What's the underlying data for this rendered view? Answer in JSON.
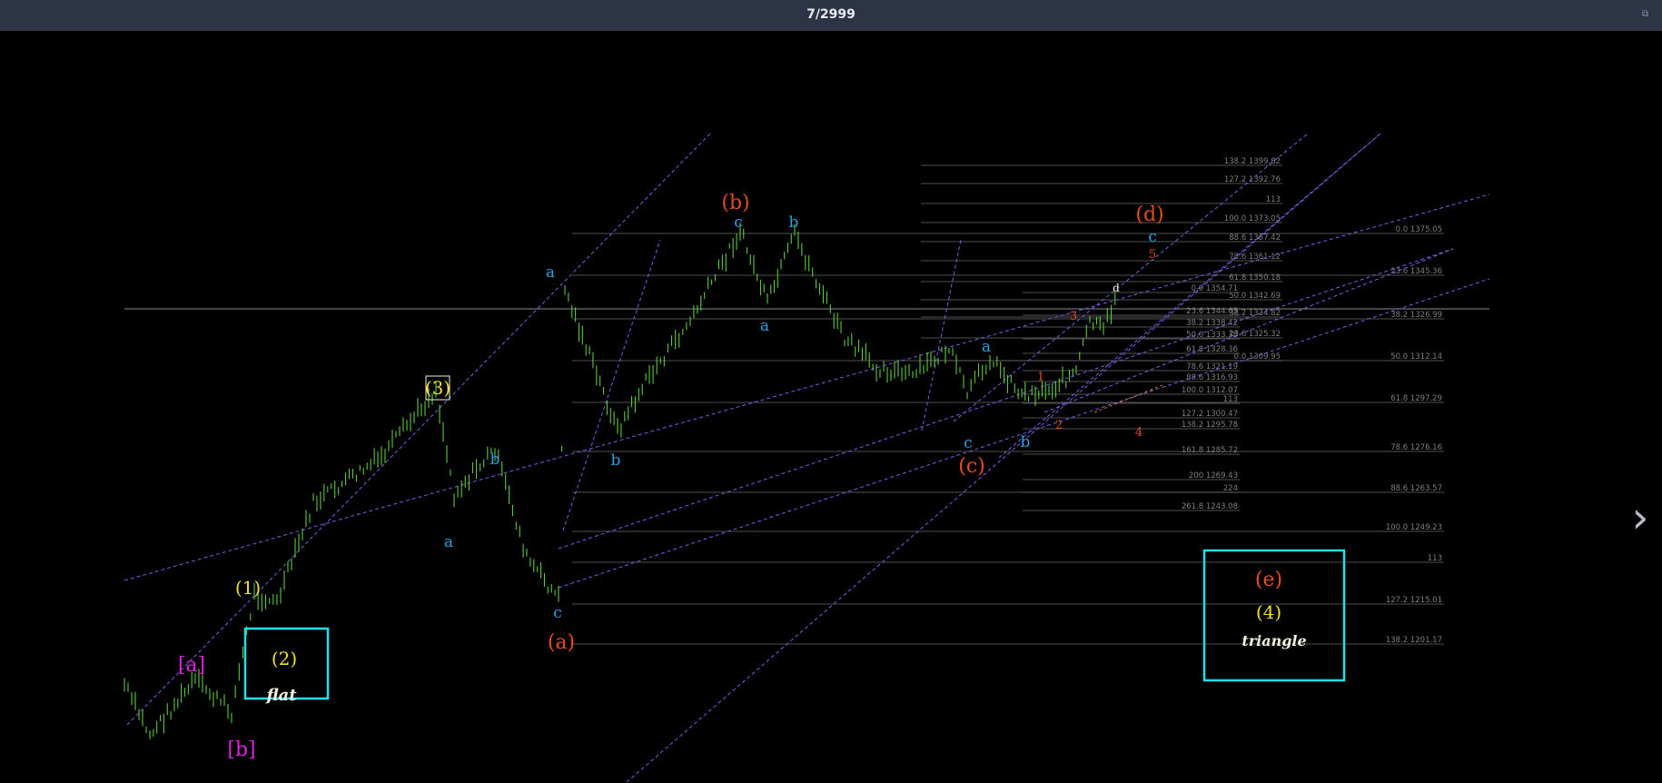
{
  "viewer": {
    "counter": "7/2999",
    "next_icon": "chevron-right-icon",
    "window_icon": "restore-icon"
  },
  "colors": {
    "candles": "#5ec83a",
    "trendline": "#6f62e0",
    "fib": "#6a6a6a",
    "fib_text": "#7e7e7e",
    "label_blue": "#2aa0e0",
    "label_red": "#e84a1e",
    "label_yellow": "#f0e020",
    "label_magenta": "#e020e0",
    "label_white": "#f4f0e0",
    "box": "#20e0e8"
  },
  "wave_labels": [
    {
      "text": "[a]",
      "color": "magenta"
    },
    {
      "text": "[b]",
      "color": "magenta"
    },
    {
      "text": "(1)",
      "color": "yellow"
    },
    {
      "text": "(2)",
      "color": "yellow"
    },
    {
      "text": "(3)",
      "color": "yellow"
    },
    {
      "text": "(4)",
      "color": "yellow"
    },
    {
      "text": "(a)",
      "color": "red"
    },
    {
      "text": "(b)",
      "color": "red"
    },
    {
      "text": "(c)",
      "color": "red"
    },
    {
      "text": "(d)",
      "color": "red"
    },
    {
      "text": "(e)",
      "color": "red"
    },
    {
      "text": "a",
      "color": "blue"
    },
    {
      "text": "b",
      "color": "blue"
    },
    {
      "text": "c",
      "color": "blue"
    },
    {
      "text": "1",
      "color": "red"
    },
    {
      "text": "2",
      "color": "red"
    },
    {
      "text": "3",
      "color": "red"
    },
    {
      "text": "4",
      "color": "red"
    },
    {
      "text": "5",
      "color": "red"
    },
    {
      "text": "d",
      "color": "white"
    },
    {
      "text": "flat",
      "color": "white"
    },
    {
      "text": "triangle",
      "color": "white"
    }
  ],
  "fib_levels_a": [
    "138.2 1399.82",
    "127.2 1392.76",
    "113",
    "100.0 1373.05",
    "88.6 1367.42",
    "78.6 1361.12",
    "61.8 1350.18",
    "50.0 1342.69",
    "38.2 1334.82",
    "23.6 1325.32",
    "0.0 1309.95"
  ],
  "fib_levels_b": [
    "0.0 1354.71",
    "23.6 1344.65",
    "38.2 1338.42",
    "50.0 1333.38",
    "61.8 1328.36",
    "78.6 1321.19",
    "88.6 1316.93",
    "100.0 1312.07",
    "113",
    "127.2 1300.47",
    "138.2 1295.78",
    "161.8 1285.72",
    "200 1269.43",
    "224",
    "261.8 1243.08"
  ],
  "fib_levels_c": [
    "0.0 1375.05",
    "23.6 1345.36",
    "38.2 1326.99",
    "50.0 1312.14",
    "61.8 1297.29",
    "78.6 1276.16",
    "88.6 1263.57",
    "100.0 1249.23",
    "113",
    "127.2 1215.01",
    "138.2 1201.17"
  ]
}
